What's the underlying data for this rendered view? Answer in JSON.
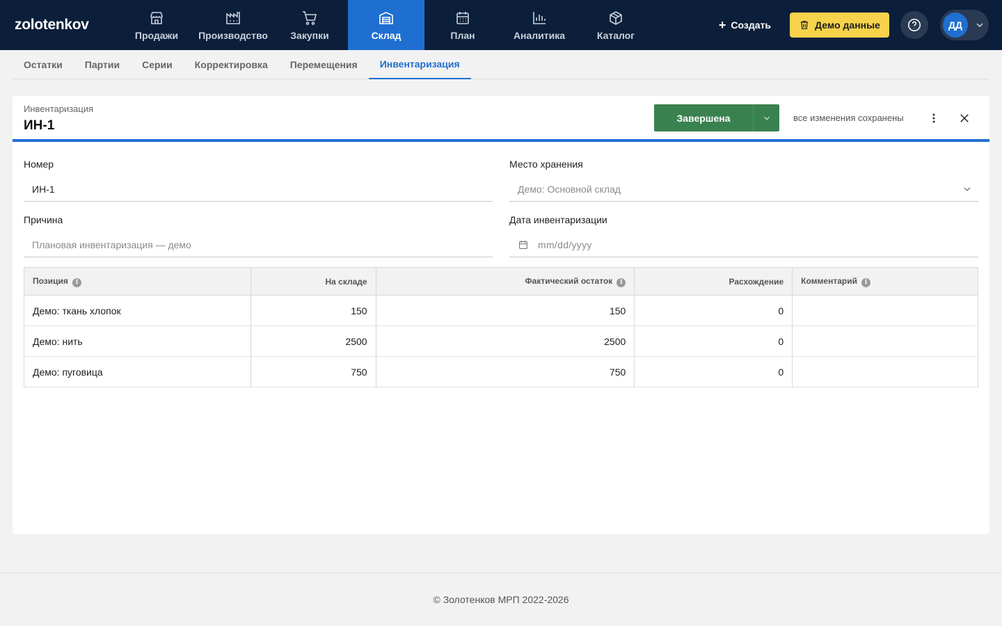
{
  "app": {
    "logo": "zolotenkov"
  },
  "nav": [
    {
      "label": "Продажи",
      "icon": "store-icon",
      "active": false
    },
    {
      "label": "Производство",
      "icon": "factory-icon",
      "active": false
    },
    {
      "label": "Закупки",
      "icon": "cart-icon",
      "active": false
    },
    {
      "label": "Склад",
      "icon": "warehouse-icon",
      "active": true
    },
    {
      "label": "План",
      "icon": "calendar-icon",
      "active": false
    },
    {
      "label": "Аналитика",
      "icon": "bar-chart-icon",
      "active": false
    },
    {
      "label": "Каталог",
      "icon": "box-icon",
      "active": false
    }
  ],
  "topbar": {
    "create_label": "Создать",
    "demo_label": "Демо данные",
    "user_initials": "ДД"
  },
  "subtabs": [
    {
      "label": "Остатки",
      "active": false
    },
    {
      "label": "Партии",
      "active": false
    },
    {
      "label": "Серии",
      "active": false
    },
    {
      "label": "Корректировка",
      "active": false
    },
    {
      "label": "Перемещения",
      "active": false
    },
    {
      "label": "Инвентаризация",
      "active": true
    }
  ],
  "doc": {
    "type": "Инвентаризация",
    "title": "ИН-1",
    "status": "Завершена",
    "status_color": "#3a8150",
    "save_state": "все изменения сохранены"
  },
  "form": {
    "number_label": "Номер",
    "number_value": "ИН-1",
    "location_label": "Место хранения",
    "location_value": "Демо: Основной склад",
    "reason_label": "Причина",
    "reason_placeholder": "Плановая инвентаризация — демо",
    "date_label": "Дата инвентаризации",
    "date_placeholder": "mm/dd/yyyy"
  },
  "table": {
    "headers": {
      "position": "Позиция",
      "in_stock": "На складе",
      "actual": "Фактический остаток",
      "diff": "Расхождение",
      "comment": "Комментарий"
    },
    "rows": [
      {
        "position": "Демо: ткань хлопок",
        "in_stock": "150",
        "actual": "150",
        "diff": "0",
        "comment": ""
      },
      {
        "position": "Демо: нить",
        "in_stock": "2500",
        "actual": "2500",
        "diff": "0",
        "comment": ""
      },
      {
        "position": "Демо: пуговица",
        "in_stock": "750",
        "actual": "750",
        "diff": "0",
        "comment": ""
      }
    ]
  },
  "footer": {
    "text": "© Золотенков МРП 2022-2026"
  },
  "colors": {
    "nav_bg": "#0b1f3a",
    "accent": "#1f6fd1",
    "demo_button": "#f6d34b"
  }
}
